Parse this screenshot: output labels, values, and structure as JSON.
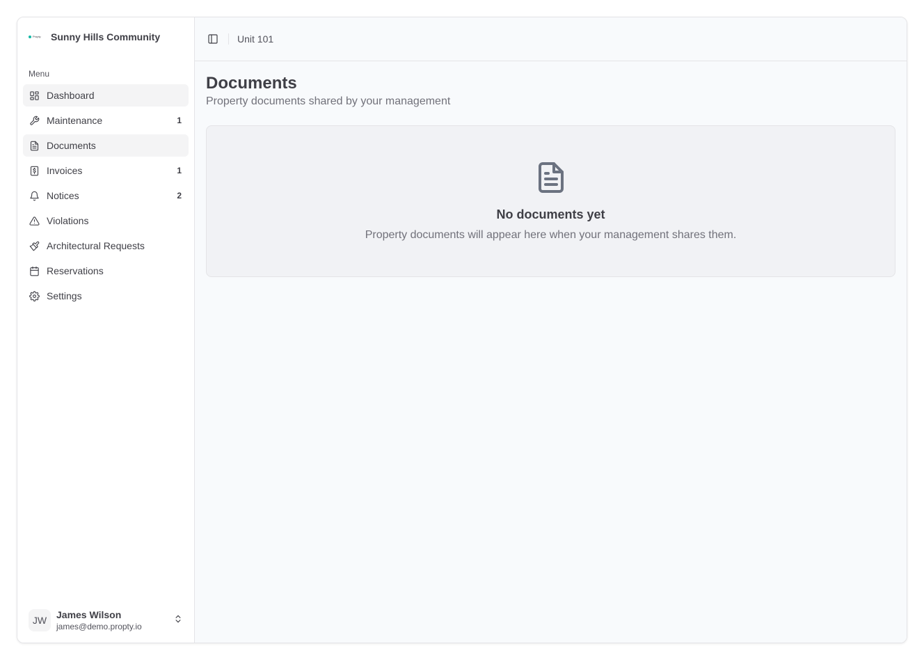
{
  "brand": {
    "logo_text": "Propty",
    "name": "Sunny Hills Community"
  },
  "sidebar": {
    "menu_label": "Menu",
    "items": [
      {
        "label": "Dashboard",
        "icon": "dashboard-icon",
        "badge": ""
      },
      {
        "label": "Maintenance",
        "icon": "wrench-icon",
        "badge": "1"
      },
      {
        "label": "Documents",
        "icon": "file-text-icon",
        "badge": ""
      },
      {
        "label": "Invoices",
        "icon": "receipt-icon",
        "badge": "1"
      },
      {
        "label": "Notices",
        "icon": "bell-icon",
        "badge": "2"
      },
      {
        "label": "Violations",
        "icon": "alert-triangle-icon",
        "badge": ""
      },
      {
        "label": "Architectural Requests",
        "icon": "paintbrush-icon",
        "badge": ""
      },
      {
        "label": "Reservations",
        "icon": "calendar-icon",
        "badge": ""
      },
      {
        "label": "Settings",
        "icon": "gear-icon",
        "badge": ""
      }
    ],
    "active_index": 2
  },
  "user": {
    "initials": "JW",
    "name": "James Wilson",
    "email": "james@demo.propty.io"
  },
  "topbar": {
    "breadcrumb": "Unit 101"
  },
  "page": {
    "title": "Documents",
    "subtitle": "Property documents shared by your management"
  },
  "empty_state": {
    "icon": "file-text-icon",
    "title": "No documents yet",
    "text": "Property documents will appear here when your management shares them."
  },
  "colors": {
    "accent": "#14b8a6",
    "main_bg": "#f8fafc",
    "empty_bg": "#f1f2f5"
  }
}
